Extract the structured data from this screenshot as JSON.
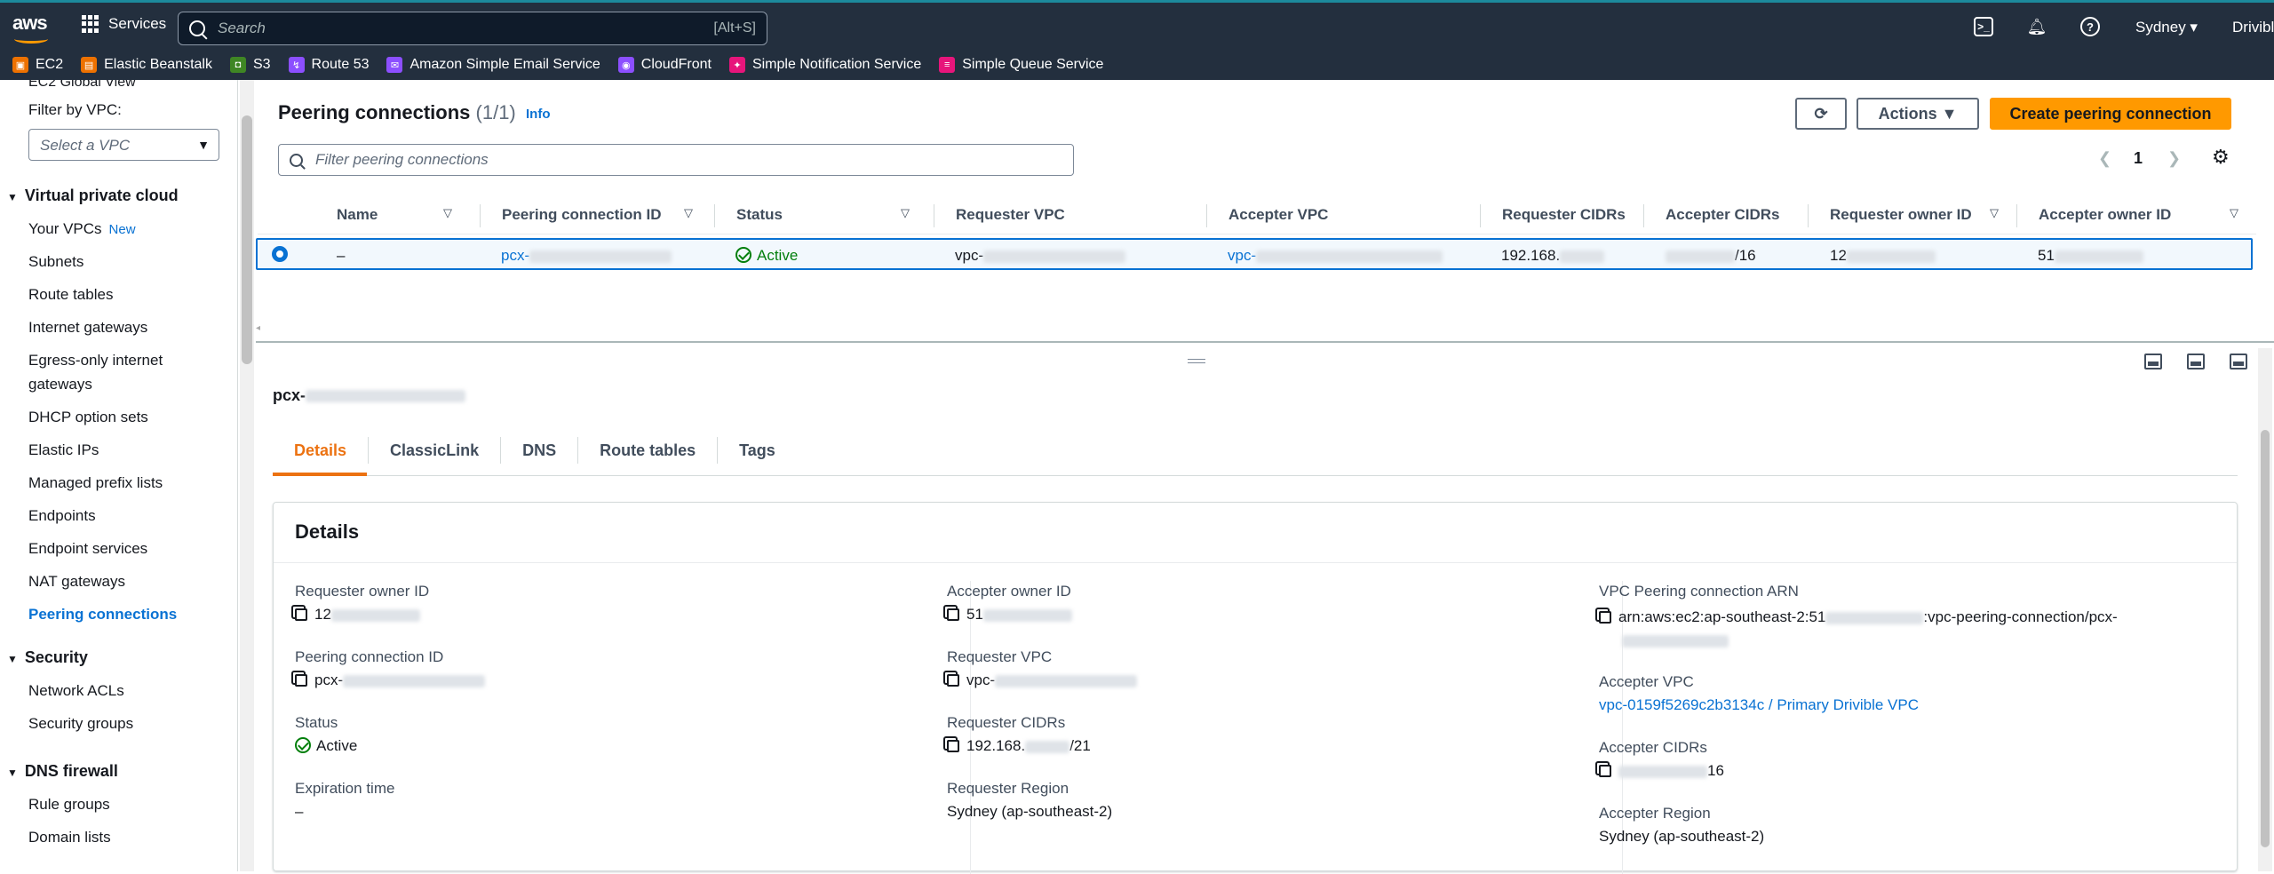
{
  "header": {
    "services_label": "Services",
    "search_placeholder": "Search",
    "search_shortcut": "[Alt+S]",
    "region": "Sydney ▾",
    "account": "Drivibl"
  },
  "favorites": [
    {
      "label": "EC2",
      "color": "#ed7100"
    },
    {
      "label": "Elastic Beanstalk",
      "color": "#ed7100"
    },
    {
      "label": "S3",
      "color": "#3f8624"
    },
    {
      "label": "Route 53",
      "color": "#8c4fff"
    },
    {
      "label": "Amazon Simple Email Service",
      "color": "#8c4fff"
    },
    {
      "label": "CloudFront",
      "color": "#8c4fff"
    },
    {
      "label": "Simple Notification Service",
      "color": "#e7157b"
    },
    {
      "label": "Simple Queue Service",
      "color": "#e7157b"
    }
  ],
  "sidebar": {
    "global_view": "EC2 Global View",
    "filter_label": "Filter by VPC:",
    "filter_placeholder": "Select a VPC",
    "sections": {
      "vpc": "Virtual private cloud",
      "security": "Security",
      "dns": "DNS firewall"
    },
    "vpc_items": [
      "Your VPCs",
      "Subnets",
      "Route tables",
      "Internet gateways",
      "Egress-only internet",
      "gateways",
      "DHCP option sets",
      "Elastic IPs",
      "Managed prefix lists",
      "Endpoints",
      "Endpoint services",
      "NAT gateways",
      "Peering connections"
    ],
    "new_badge": "New",
    "security_items": [
      "Network ACLs",
      "Security groups"
    ],
    "dns_items": [
      "Rule groups",
      "Domain lists"
    ]
  },
  "list": {
    "title": "Peering connections",
    "count": "(1/1)",
    "info": "Info",
    "actions_label": "Actions ▼",
    "create_label": "Create peering connection",
    "filter_placeholder": "Filter peering connections",
    "page": "1",
    "columns": [
      "Name",
      "Peering connection ID",
      "Status",
      "Requester VPC",
      "Accepter VPC",
      "Requester CIDRs",
      "Accepter CIDRs",
      "Requester owner ID",
      "Accepter owner ID"
    ],
    "row": {
      "name": "–",
      "id_prefix": "pcx-",
      "status": "Active",
      "requester_vpc_prefix": "vpc-",
      "accepter_vpc_prefix": "vpc-",
      "req_cidr_prefix": "192.168.",
      "acc_cidr_suffix": "/16",
      "req_owner_prefix": "12",
      "acc_owner_prefix": "51"
    }
  },
  "detail": {
    "title_prefix": "pcx-",
    "tabs": [
      "Details",
      "ClassicLink",
      "DNS",
      "Route tables",
      "Tags"
    ],
    "card_title": "Details",
    "col1": {
      "requester_owner_label": "Requester owner ID",
      "requester_owner_prefix": "12",
      "pcx_label": "Peering connection ID",
      "pcx_prefix": "pcx-",
      "status_label": "Status",
      "status_value": "Active",
      "expiration_label": "Expiration time",
      "expiration_value": "–"
    },
    "col2": {
      "accepter_owner_label": "Accepter owner ID",
      "accepter_owner_prefix": "51",
      "requester_vpc_label": "Requester VPC",
      "requester_vpc_prefix": "vpc-",
      "requester_cidrs_label": "Requester CIDRs",
      "requester_cidrs_prefix": "192.168.",
      "requester_cidrs_suffix": "/21",
      "requester_region_label": "Requester Region",
      "requester_region_value": "Sydney (ap-southeast-2)"
    },
    "col3": {
      "arn_label": "VPC Peering connection ARN",
      "arn_prefix": "arn:aws:ec2:ap-southeast-2:51",
      "arn_suffix": ":vpc-peering-connection/pcx-",
      "accepter_vpc_label": "Accepter VPC",
      "accepter_vpc_value": "vpc-0159f5269c2b3134c / Primary Drivible VPC",
      "accepter_cidrs_label": "Accepter CIDRs",
      "accepter_cidrs_suffix": "16",
      "accepter_region_label": "Accepter Region",
      "accepter_region_value": "Sydney (ap-southeast-2)"
    }
  }
}
